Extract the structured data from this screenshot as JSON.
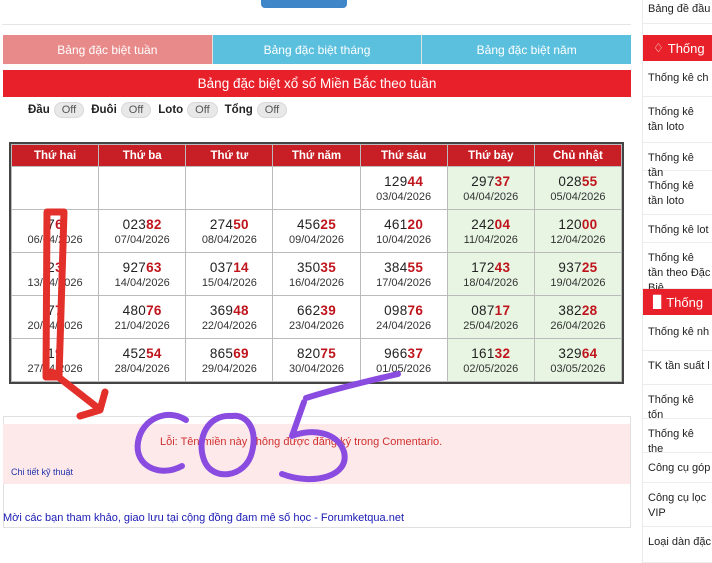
{
  "tabs": [
    "Bảng đặc biệt tuần",
    "Bảng đặc biệt tháng",
    "Bảng đặc biệt năm"
  ],
  "panel_title": "Bảng đặc biệt xổ số Miền Bắc theo tuần",
  "filters": [
    {
      "label": "Đầu",
      "state": "Off"
    },
    {
      "label": "Đuôi",
      "state": "Off"
    },
    {
      "label": "Loto",
      "state": "Off"
    },
    {
      "label": "Tổng",
      "state": "Off"
    }
  ],
  "table": {
    "headers": [
      "Thứ hai",
      "Thứ ba",
      "Thứ tư",
      "Thứ năm",
      "Thứ sáu",
      "Thứ bảy",
      "Chủ nhật"
    ],
    "rows": [
      [
        null,
        null,
        null,
        null,
        {
          "pre": "129",
          "tail": "44",
          "date": "03/04/2026"
        },
        {
          "pre": "297",
          "tail": "37",
          "date": "04/04/2026"
        },
        {
          "pre": "028",
          "tail": "55",
          "date": "05/04/2026"
        }
      ],
      [
        {
          "pre": "7",
          "tail": "6",
          "date": "06/04/2026"
        },
        {
          "pre": "023",
          "tail": "82",
          "date": "07/04/2026"
        },
        {
          "pre": "274",
          "tail": "50",
          "date": "08/04/2026"
        },
        {
          "pre": "456",
          "tail": "25",
          "date": "09/04/2026"
        },
        {
          "pre": "461",
          "tail": "20",
          "date": "10/04/2026"
        },
        {
          "pre": "242",
          "tail": "04",
          "date": "11/04/2026"
        },
        {
          "pre": "120",
          "tail": "00",
          "date": "12/04/2026"
        }
      ],
      [
        {
          "pre": "2",
          "tail": "3",
          "date": "13/04/2026"
        },
        {
          "pre": "927",
          "tail": "63",
          "date": "14/04/2026"
        },
        {
          "pre": "037",
          "tail": "14",
          "date": "15/04/2026"
        },
        {
          "pre": "350",
          "tail": "35",
          "date": "16/04/2026"
        },
        {
          "pre": "384",
          "tail": "55",
          "date": "17/04/2026"
        },
        {
          "pre": "172",
          "tail": "43",
          "date": "18/04/2026"
        },
        {
          "pre": "937",
          "tail": "25",
          "date": "19/04/2026"
        }
      ],
      [
        {
          "pre": "7",
          "tail": "7",
          "date": "20/04/2026"
        },
        {
          "pre": "480",
          "tail": "76",
          "date": "21/04/2026"
        },
        {
          "pre": "369",
          "tail": "48",
          "date": "22/04/2026"
        },
        {
          "pre": "662",
          "tail": "39",
          "date": "23/04/2026"
        },
        {
          "pre": "098",
          "tail": "76",
          "date": "24/04/2026"
        },
        {
          "pre": "087",
          "tail": "17",
          "date": "25/04/2026"
        },
        {
          "pre": "382",
          "tail": "28",
          "date": "26/04/2026"
        }
      ],
      [
        {
          "pre": "1",
          "tail": "9",
          "date": "27/04/2026"
        },
        {
          "pre": "452",
          "tail": "54",
          "date": "28/04/2026"
        },
        {
          "pre": "865",
          "tail": "69",
          "date": "29/04/2026"
        },
        {
          "pre": "820",
          "tail": "75",
          "date": "30/04/2026"
        },
        {
          "pre": "966",
          "tail": "37",
          "date": "01/05/2026"
        },
        {
          "pre": "161",
          "tail": "32",
          "date": "02/05/2026"
        },
        {
          "pre": "329",
          "tail": "64",
          "date": "03/05/2026"
        }
      ]
    ]
  },
  "error": {
    "message": "Lỗi: Tên miền này không được đăng ký trong Comentario.",
    "tech_link": "Chi tiết kỹ thuật"
  },
  "forum_link": "Mời các bạn tham khảo, giao lưu tại cộng đồng đam mê số học - Forumketqua.net",
  "annotation_text": "CO 5",
  "sidebar": {
    "top_item": "Bảng đề đầu",
    "section1_title": "Thống",
    "section1_items": [
      "Thống kê ch",
      "Thống kê tần loto",
      "Thống kê tần",
      "Thống kê tần loto",
      "Thống kê lot",
      "Thống kê tần theo Đặc Biệ"
    ],
    "section2_title": "Thống",
    "section2_items": [
      "Thống kê nh",
      "TK tần suất l",
      "Thống kê tốn",
      "Thống kê the",
      "Công cụ góp",
      "Công cụ lọc VIP",
      "Loại dàn đặc"
    ]
  },
  "colors": {
    "header_red": "#e8202a",
    "tab_active": "#e88a8a",
    "tab": "#5bc0de",
    "weekend_green": "#e8f5e3",
    "annotation_purple": "#8a4be0",
    "annotation_red": "#e3302a"
  }
}
